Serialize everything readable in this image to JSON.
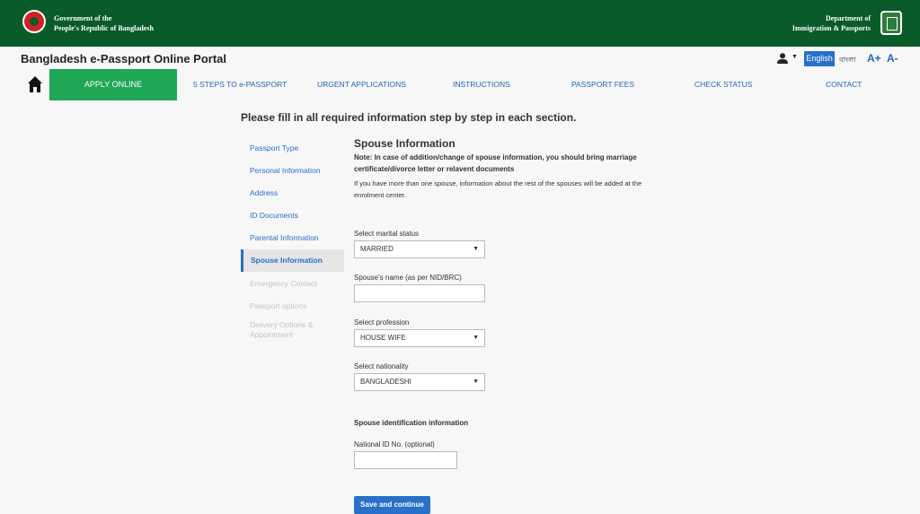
{
  "header": {
    "gov_line1": "Government of the",
    "gov_line2": "People's Republic of Bangladesh",
    "dept_line1": "Department of",
    "dept_line2": "Immigration & Passports",
    "brand_color": "#0a5b2a"
  },
  "portal": {
    "title": "Bangladesh e-Passport Online Portal",
    "lang_en": "English",
    "lang_bn": "বাংলা",
    "font_increase": "A+",
    "font_decrease": "A-"
  },
  "nav": {
    "active": "APPLY ONLINE",
    "items": [
      "5 STEPS TO e-PASSPORT",
      "URGENT APPLICATIONS",
      "INSTRUCTIONS",
      "PASSPORT FEES",
      "CHECK STATUS",
      "CONTACT"
    ],
    "active_color": "#1fa756"
  },
  "main": {
    "heading": "Please fill in all required information step by step in each section."
  },
  "sidebar": {
    "items": [
      {
        "label": "Passport Type"
      },
      {
        "label": "Personal Information"
      },
      {
        "label": "Address"
      },
      {
        "label": "ID Documents"
      },
      {
        "label": "Parental Information"
      },
      {
        "label": "Spouse Information"
      },
      {
        "label": "Emergency Contact"
      },
      {
        "label": "Passport options"
      },
      {
        "label": "Delivery Options &"
      },
      {
        "label": "Appointment"
      }
    ]
  },
  "form": {
    "title": "Spouse Information",
    "note_line1": "Note: In case of addition/change of spouse information, you should bring marriage",
    "note_line2": "certificate/divorce letter or relavent documents",
    "info_line1": "If you have more than one spouse, information about the rest of the spouses will be added at the",
    "info_line2": "enrolment center.",
    "marital_label": "Select marital status",
    "marital_value": "MARRIED",
    "spouse_name_label": "Spouse's name (as per NID/BRC)",
    "spouse_name_value": "",
    "profession_label": "Select profession",
    "profession_value": "HOUSE WIFE",
    "nationality_label": "Select nationality",
    "nationality_value": "BANGLADESHI",
    "spouse_id_heading": "Spouse identification information",
    "nid_label": "National ID No. (optional)",
    "nid_value": "",
    "submit_label": "Save and continue",
    "accent_color": "#2870c9"
  }
}
